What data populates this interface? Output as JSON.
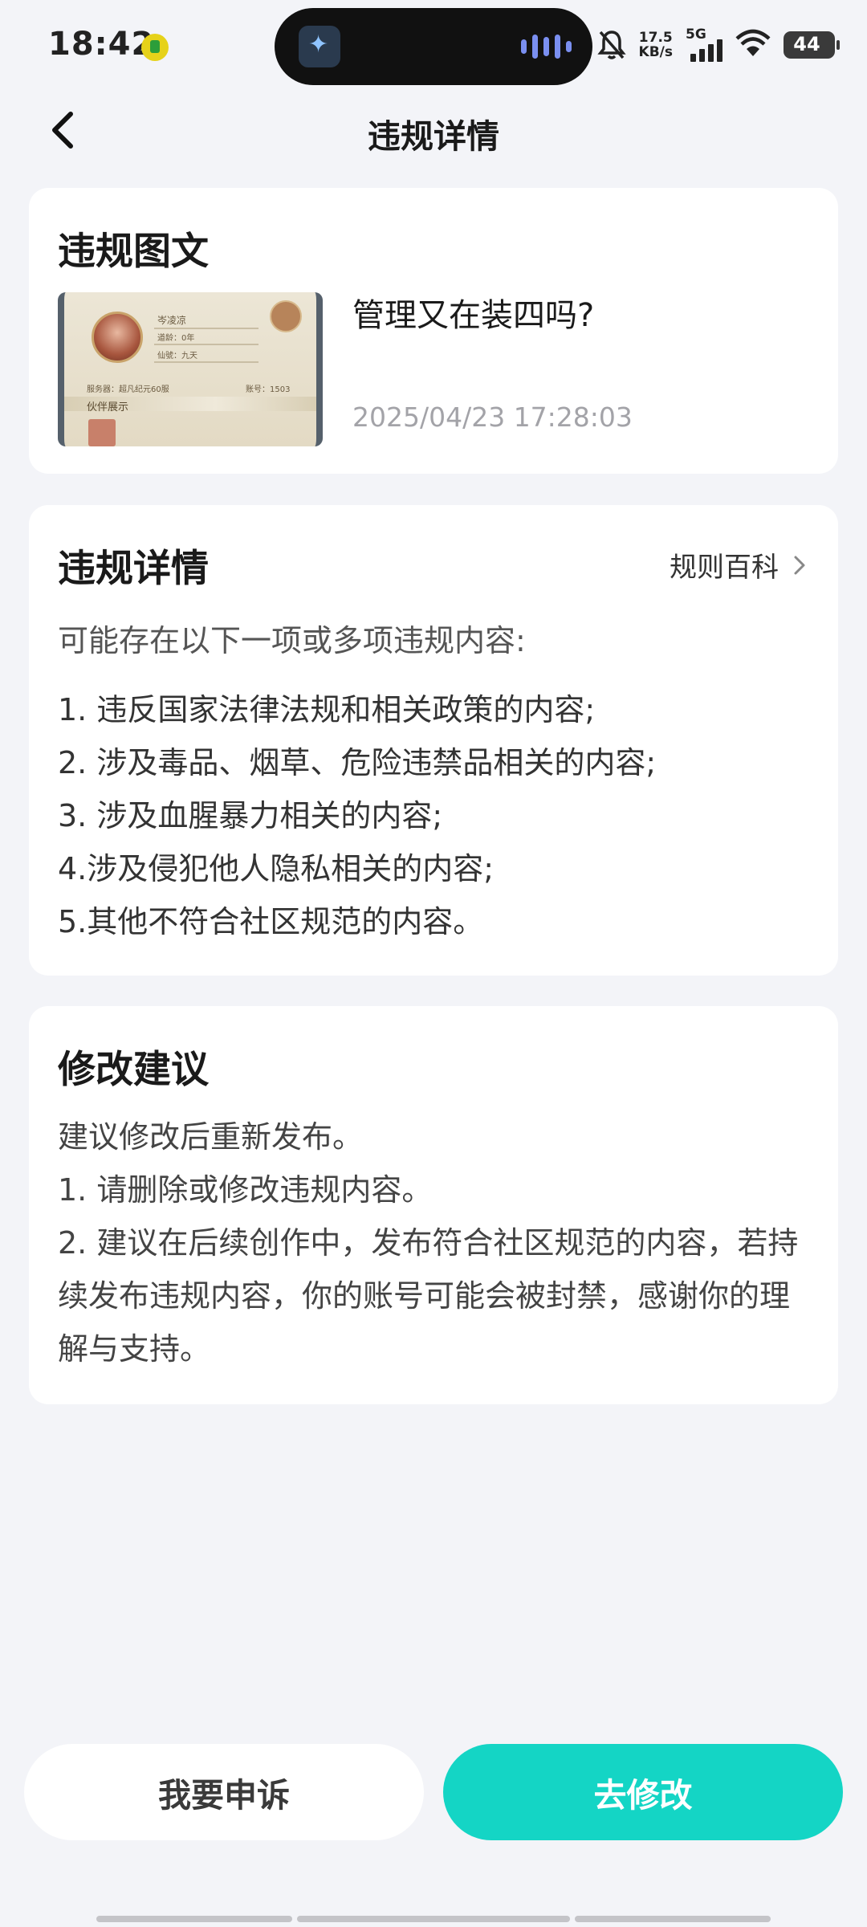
{
  "status_bar": {
    "time": "18:42",
    "net_speed_value": "17.5",
    "net_speed_unit": "KB/s",
    "network_type": "5G",
    "battery": "44",
    "icons": [
      "music-app-icon",
      "mute-bell-icon",
      "signal-icon",
      "wifi-icon",
      "battery-icon"
    ]
  },
  "header": {
    "title": "违规详情",
    "back_icon": "chevron-left-icon"
  },
  "violation_post": {
    "section_title": "违规图文",
    "post_title": "管理又在装四吗?",
    "post_time": "2025/04/23 17:28:03",
    "thumbnail": {
      "name": "岑凌凉",
      "age": "道龄：0年",
      "realm": "仙號：九天",
      "server": "服务器：超凡纪元60服",
      "account": "账号：1503",
      "tag": "伙伴展示"
    }
  },
  "violation_detail": {
    "section_title": "违规详情",
    "rules_link": "规则百科",
    "intro": "可能存在以下一项或多项违规内容:",
    "items": [
      "1. 违反国家法律法规和相关政策的内容;",
      "2. 涉及毒品、烟草、危险违禁品相关的内容;",
      "3. 涉及血腥暴力相关的内容;",
      "4.涉及侵犯他人隐私相关的内容;",
      "5.其他不符合社区规范的内容。"
    ]
  },
  "suggestion": {
    "section_title": "修改建议",
    "lines": [
      "建议修改后重新发布。",
      "1. 请删除或修改违规内容。",
      "2. 建议在后续创作中，发布符合社区规范的内容，若持续发布违规内容，你的账号可能会被封禁，感谢你的理解与支持。"
    ]
  },
  "actions": {
    "appeal_label": "我要申诉",
    "modify_label": "去修改"
  },
  "colors": {
    "accent": "#14d5c5",
    "background": "#f3f4f8"
  }
}
